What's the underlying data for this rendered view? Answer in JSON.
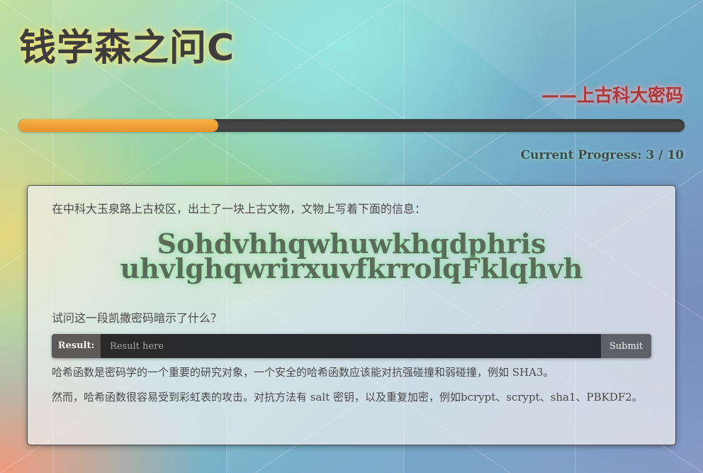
{
  "header": {
    "title": "钱学森之问C",
    "subtitle": "——上古科大密码"
  },
  "progress": {
    "current": 3,
    "total": 10,
    "text": "Current Progress: 3 / 10"
  },
  "panel": {
    "intro": "在中科大玉泉路上古校区，出土了一块上古文物，文物上写着下面的信息：",
    "cipher_line_1": "Sohdvhhqwhuwkhqdphris",
    "cipher_line_2": "uhvlghqwrirxuvfkrrolqFklqhvh",
    "question": "试问这一段凯撒密码暗示了什么？",
    "result_label": "Result:",
    "result_placeholder": "Result here",
    "result_value": "",
    "submit_label": "Submit",
    "note_1": "哈希函数是密码学的一个重要的研究对象，一个安全的哈希函数应该能对抗强碰撞和弱碰撞，例如 SHA3。",
    "note_2": "然而，哈希函数很容易受到彩虹表的攻击。对抗方法有 salt 密钥，以及重复加密，例如bcrypt、scrypt、sha1、PBKDF2。"
  },
  "colors": {
    "progress_fill": "#ee9d31",
    "progress_track": "#444444",
    "title_glow": "#fae66e",
    "subtitle": "#a83a3a"
  }
}
